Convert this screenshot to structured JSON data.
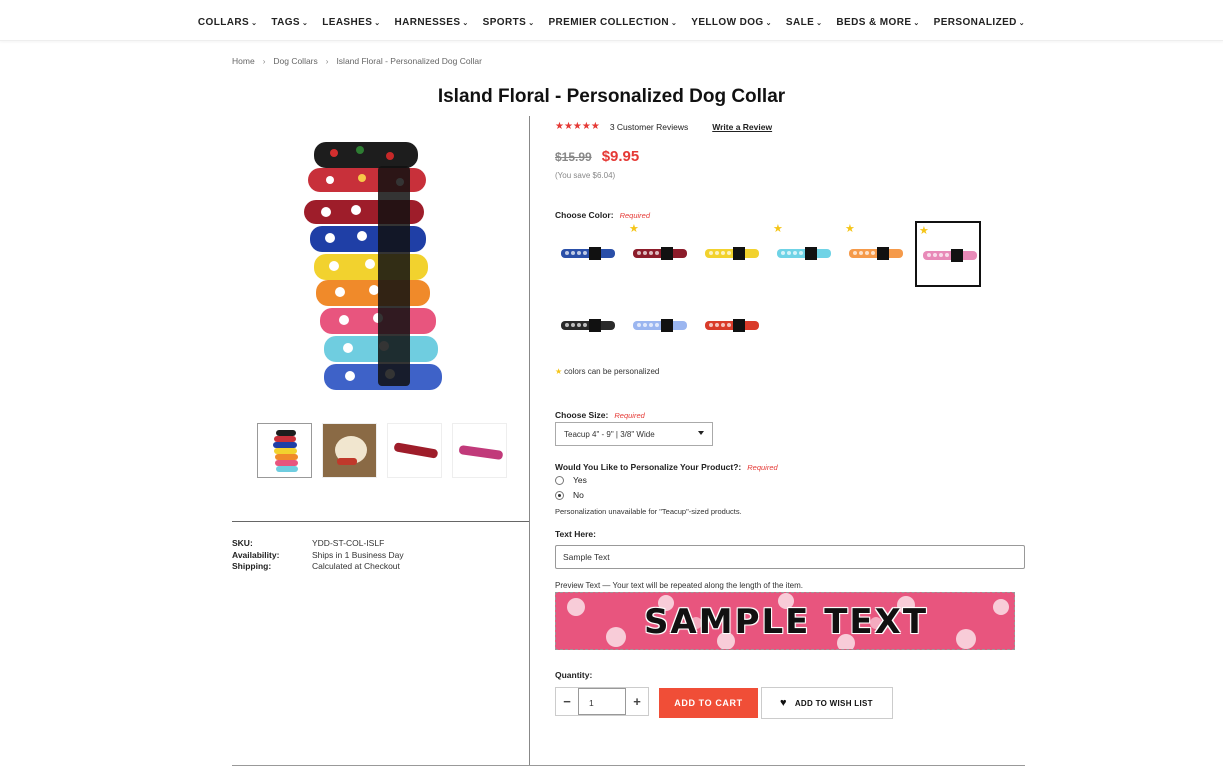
{
  "nav": {
    "items": [
      "COLLARS",
      "TAGS",
      "LEASHES",
      "HARNESSES",
      "SPORTS",
      "PREMIER COLLECTION",
      "YELLOW DOG",
      "SALE",
      "BEDS & MORE",
      "PERSONALIZED"
    ]
  },
  "breadcrumb": [
    "Home",
    "Dog Collars",
    "Island Floral - Personalized Dog Collar"
  ],
  "product": {
    "title": "Island Floral - Personalized Dog Collar",
    "rating_stars": 5,
    "reviews_text": "3 Customer Reviews",
    "write_review": "Write a Review",
    "old_price": "$15.99",
    "price": "$9.95",
    "savings": "(You save $6.04)"
  },
  "specs": [
    {
      "key": "SKU:",
      "value": "YDD-ST-COL-ISLF"
    },
    {
      "key": "Availability:",
      "value": "Ships in 1 Business Day"
    },
    {
      "key": "Shipping:",
      "value": "Calculated at Checkout"
    }
  ],
  "options": {
    "color_label": "Choose Color:",
    "required": "Required",
    "swatches": [
      {
        "color": "#2a4fa8",
        "personalizable": false,
        "selected": false
      },
      {
        "color": "#8c1c2a",
        "personalizable": true,
        "selected": false
      },
      {
        "color": "#f2d22e",
        "personalizable": false,
        "selected": false
      },
      {
        "color": "#6fd3e6",
        "personalizable": true,
        "selected": false
      },
      {
        "color": "#f59a4a",
        "personalizable": true,
        "selected": false
      },
      {
        "color": "#e88ab8",
        "personalizable": true,
        "selected": true
      },
      {
        "color": "#2a2a2a",
        "personalizable": false,
        "selected": false
      },
      {
        "color": "#9bb6f0",
        "personalizable": false,
        "selected": false
      },
      {
        "color": "#d93b2a",
        "personalizable": false,
        "selected": false
      }
    ],
    "personalizable_note": "colors can be personalized",
    "size_label": "Choose Size:",
    "size_value": "Teacup 4\" - 9\" | 3/8\" Wide",
    "personalize_label": "Would You Like to Personalize Your Product?:",
    "personalize_yes": "Yes",
    "personalize_no": "No",
    "personalize_note": "Personalization unavailable for \"Teacup\"-sized products.",
    "text_label": "Text Here:",
    "text_value": "Sample Text",
    "preview_note": "Preview Text — Your text will be repeated along the length of the item.",
    "preview_text": "SAMPLE TEXT",
    "quantity_label": "Quantity:",
    "quantity_value": "1",
    "add_to_cart": "ADD TO CART",
    "wish_list": "ADD TO WISH LIST"
  }
}
